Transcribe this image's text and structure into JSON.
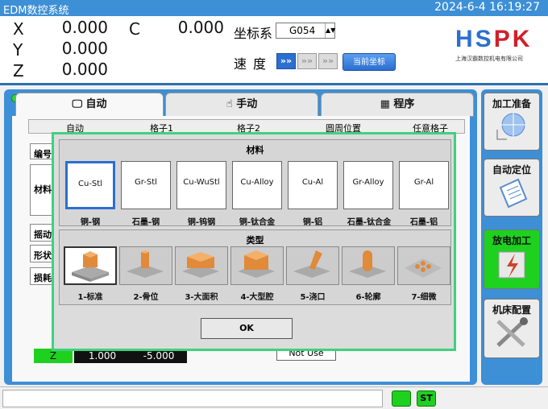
{
  "titlebar": {
    "title": "EDM数控系统",
    "datetime": "2024-6-4 16:19:27"
  },
  "axes": [
    {
      "name": "X",
      "value": "0.000"
    },
    {
      "name": "Y",
      "value": "0.000"
    },
    {
      "name": "Z",
      "value": "0.000"
    },
    {
      "name": "C",
      "value": "0.000"
    }
  ],
  "coord": {
    "label": "坐标系",
    "value": "G054"
  },
  "speed": {
    "label": "速度",
    "current_button": "当前坐标"
  },
  "logo": {
    "brand_a": "HS",
    "brand_b": "PK",
    "company": "上海汉霸数控机电有限公司"
  },
  "tabs": [
    {
      "label": "自动",
      "icon": "monitor-icon"
    },
    {
      "label": "手动",
      "icon": "hand-icon"
    },
    {
      "label": "程序",
      "icon": "grid-icon"
    }
  ],
  "subtabs": [
    "自动",
    "格子1",
    "格子2",
    "圆周位置",
    "任意格子"
  ],
  "left_labels": [
    "编号",
    "材料",
    "摇动",
    "形状",
    "损耗"
  ],
  "dialog": {
    "materials_title": "材料",
    "materials": [
      {
        "code": "Cu-Stl",
        "label": "铜-钢"
      },
      {
        "code": "Gr-Stl",
        "label": "石墨-钢"
      },
      {
        "code": "Cu-WuStl",
        "label": "铜-钨钢"
      },
      {
        "code": "Cu-Alloy",
        "label": "铜-钛合金"
      },
      {
        "code": "Cu-Al",
        "label": "铜-铝"
      },
      {
        "code": "Gr-Alloy",
        "label": "石墨-钛合金"
      },
      {
        "code": "Gr-Al",
        "label": "石墨-铝"
      }
    ],
    "types_title": "类型",
    "types": [
      {
        "label": "1-标准"
      },
      {
        "label": "2-骨位"
      },
      {
        "label": "3-大面积"
      },
      {
        "label": "4-大型腔"
      },
      {
        "label": "5-浇口"
      },
      {
        "label": "6-轮廓"
      },
      {
        "label": "7-细微"
      }
    ],
    "ok_label": "OK"
  },
  "bottom_row": {
    "axis": "Z",
    "v1": "1.000",
    "v2": "-5.000",
    "not_use": "Not Use"
  },
  "sidebar": [
    {
      "label": "加工准备",
      "icon": "crosshair-icon"
    },
    {
      "label": "自动定位",
      "icon": "clipboard-icon"
    },
    {
      "label": "放电加工",
      "icon": "spark-icon"
    },
    {
      "label": "机床配置",
      "icon": "tools-icon"
    }
  ],
  "status": {
    "st_label": "ST"
  }
}
